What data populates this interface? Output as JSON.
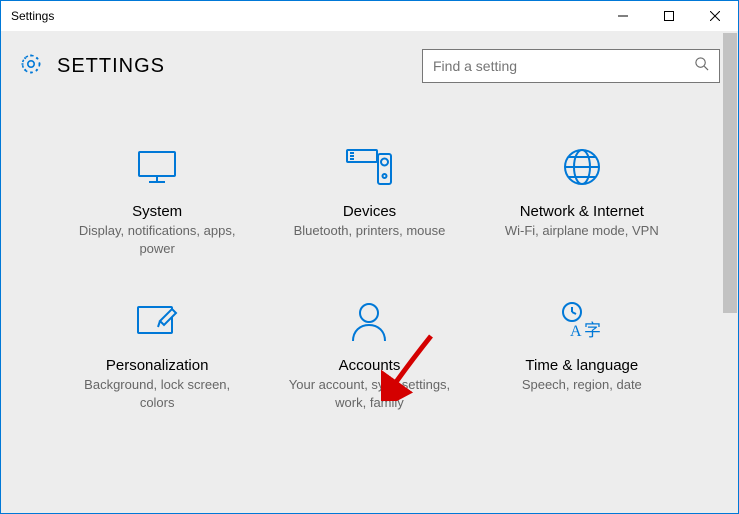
{
  "window": {
    "title": "Settings"
  },
  "header": {
    "title": "SETTINGS"
  },
  "search": {
    "placeholder": "Find a setting"
  },
  "tiles": [
    {
      "name": "system",
      "title": "System",
      "desc": "Display, notifications, apps, power"
    },
    {
      "name": "devices",
      "title": "Devices",
      "desc": "Bluetooth, printers, mouse"
    },
    {
      "name": "network",
      "title": "Network & Internet",
      "desc": "Wi-Fi, airplane mode, VPN"
    },
    {
      "name": "personalization",
      "title": "Personalization",
      "desc": "Background, lock screen, colors"
    },
    {
      "name": "accounts",
      "title": "Accounts",
      "desc": "Your account, sync settings, work, family"
    },
    {
      "name": "timelang",
      "title": "Time & language",
      "desc": "Speech, region, date"
    }
  ],
  "colors": {
    "accent": "#0078d7"
  }
}
